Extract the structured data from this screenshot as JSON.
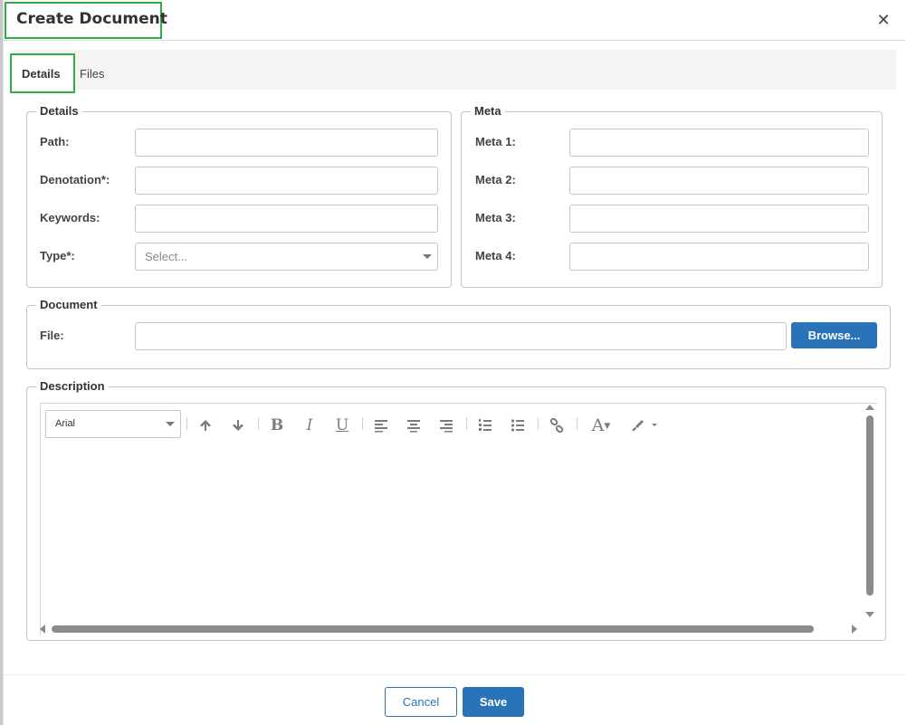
{
  "dialog": {
    "title": "Create Document",
    "close_icon": "close-icon"
  },
  "tabs": [
    {
      "label": "Details",
      "active": true
    },
    {
      "label": "Files",
      "active": false
    }
  ],
  "details": {
    "legend": "Details",
    "fields": [
      {
        "label": "Path:",
        "value": ""
      },
      {
        "label": "Denotation*:",
        "value": ""
      },
      {
        "label": "Keywords:",
        "value": ""
      },
      {
        "label": "Type*:",
        "placeholder": "Select..."
      }
    ]
  },
  "meta": {
    "legend": "Meta",
    "fields": [
      {
        "label": "Meta 1:",
        "value": ""
      },
      {
        "label": "Meta 2:",
        "value": ""
      },
      {
        "label": "Meta 3:",
        "value": ""
      },
      {
        "label": "Meta 4:",
        "value": ""
      }
    ]
  },
  "document": {
    "legend": "Document",
    "file_label": "File:",
    "file_value": "",
    "browse_label": "Browse..."
  },
  "description": {
    "legend": "Description",
    "font": "Arial",
    "toolbar": [
      "arrow-up-icon",
      "arrow-down-icon",
      "bold-icon",
      "italic-icon",
      "underline-icon",
      "align-left-icon",
      "align-center-icon",
      "align-right-icon",
      "ordered-list-icon",
      "unordered-list-icon",
      "link-icon",
      "font-color-icon",
      "highlight-brush-icon"
    ],
    "toolbar_glyphs": {
      "bold": "B",
      "italic": "I",
      "underline": "U",
      "font_color": "A"
    }
  },
  "footer": {
    "cancel_label": "Cancel",
    "save_label": "Save"
  },
  "colors": {
    "primary": "#2b73b9",
    "highlight_border": "#2fae4a"
  }
}
